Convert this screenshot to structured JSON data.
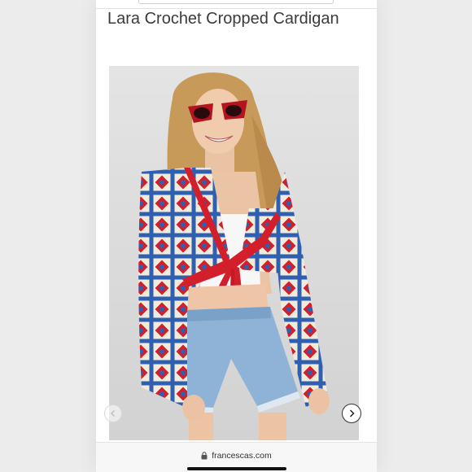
{
  "product": {
    "title": "Lara Crochet Cropped Cardigan"
  },
  "carousel": {
    "prev_icon": "chevron-left-icon",
    "next_icon": "chevron-right-icon"
  },
  "browser": {
    "domain": "francescas.com",
    "lock_icon": "lock-icon"
  },
  "colors": {
    "accent_red": "#d21f2b",
    "crochet_blue": "#2f5fb0",
    "crochet_cream": "#f1ebdc",
    "denim": "#8fb3d6"
  }
}
